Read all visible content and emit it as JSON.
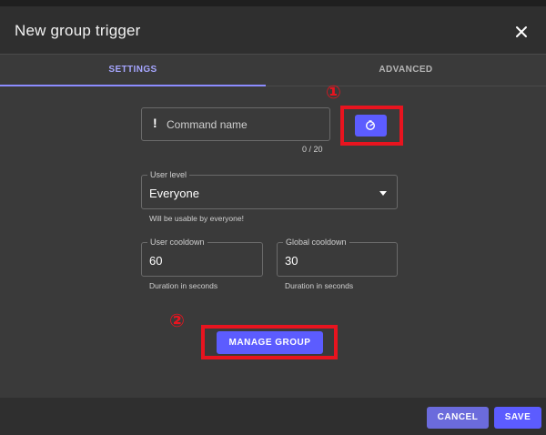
{
  "dialog": {
    "title": "New group trigger"
  },
  "tabs": [
    {
      "label": "SETTINGS"
    },
    {
      "label": "ADVANCED"
    }
  ],
  "command": {
    "placeholder": "Command name",
    "value": "",
    "counter": "0 / 20"
  },
  "user_level": {
    "label": "User level",
    "value": "Everyone",
    "hint": "Will be usable by everyone!"
  },
  "user_cooldown": {
    "label": "User cooldown",
    "value": "60",
    "hint": "Duration in seconds"
  },
  "global_cooldown": {
    "label": "Global cooldown",
    "value": "30",
    "hint": "Duration in seconds"
  },
  "manage_group": {
    "label": "MANAGE GROUP"
  },
  "annotations": [
    {
      "label": "①"
    },
    {
      "label": "②"
    }
  ],
  "footer": {
    "cancel_label": "CANCEL",
    "save_label": "SAVE"
  },
  "icons": {
    "close": "close-icon",
    "timer": "timer-icon",
    "warning": "exclamation-icon",
    "dropdown": "caret-down-icon"
  },
  "colors": {
    "accent": "#5c5cff",
    "tab_active": "#a6a6ff",
    "annotation": "#e8141f"
  }
}
